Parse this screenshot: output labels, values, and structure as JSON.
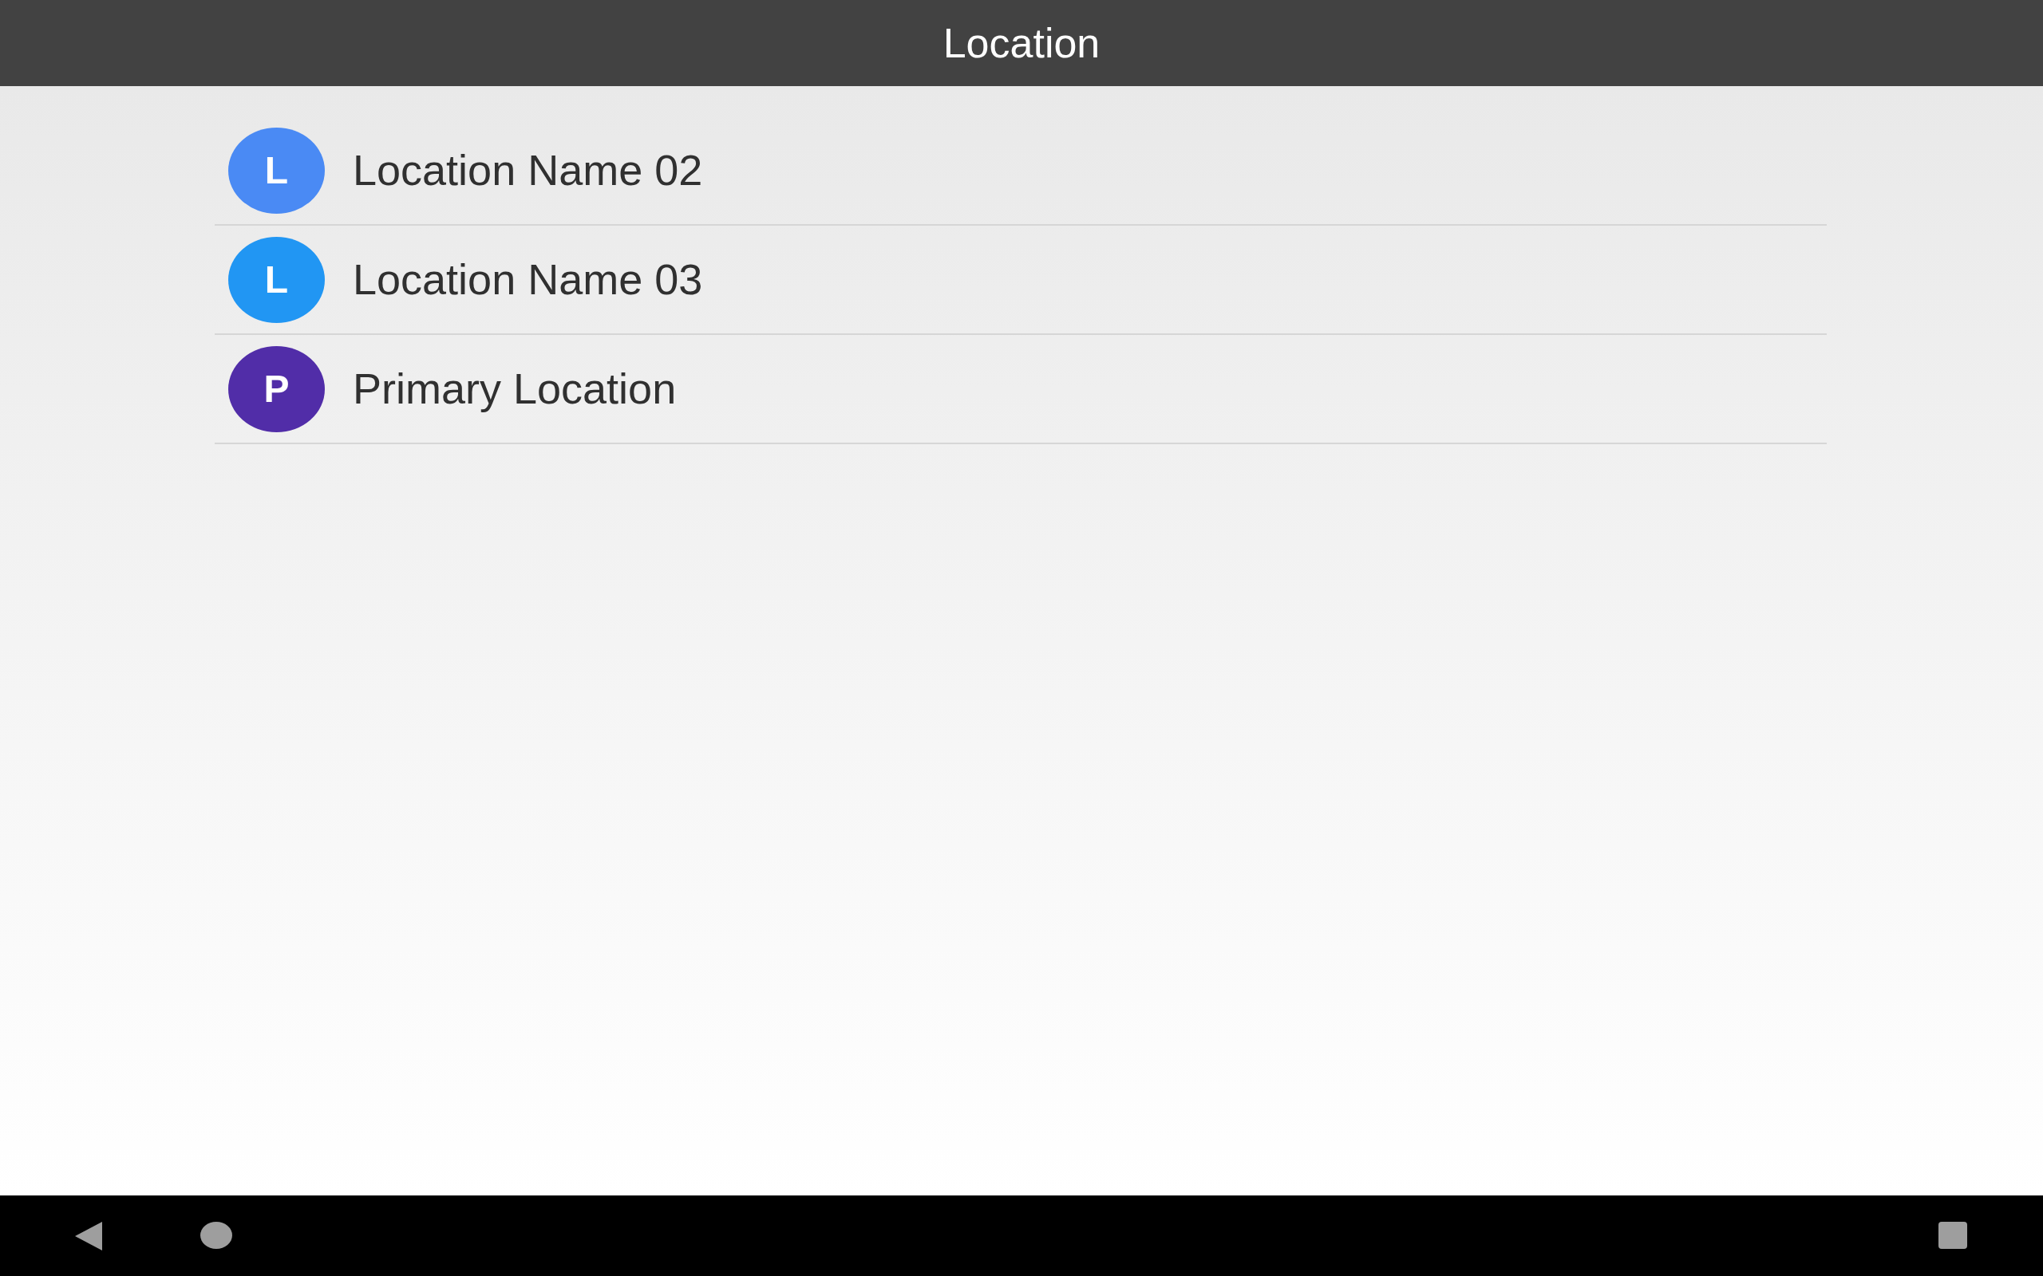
{
  "app_bar": {
    "title": "Location"
  },
  "locations": [
    {
      "initial": "L",
      "name": "Location Name 02",
      "color": "#4a8af4"
    },
    {
      "initial": "L",
      "name": "Location Name 03",
      "color": "#2196f3"
    },
    {
      "initial": "P",
      "name": "Primary Location",
      "color": "#512da8"
    }
  ]
}
